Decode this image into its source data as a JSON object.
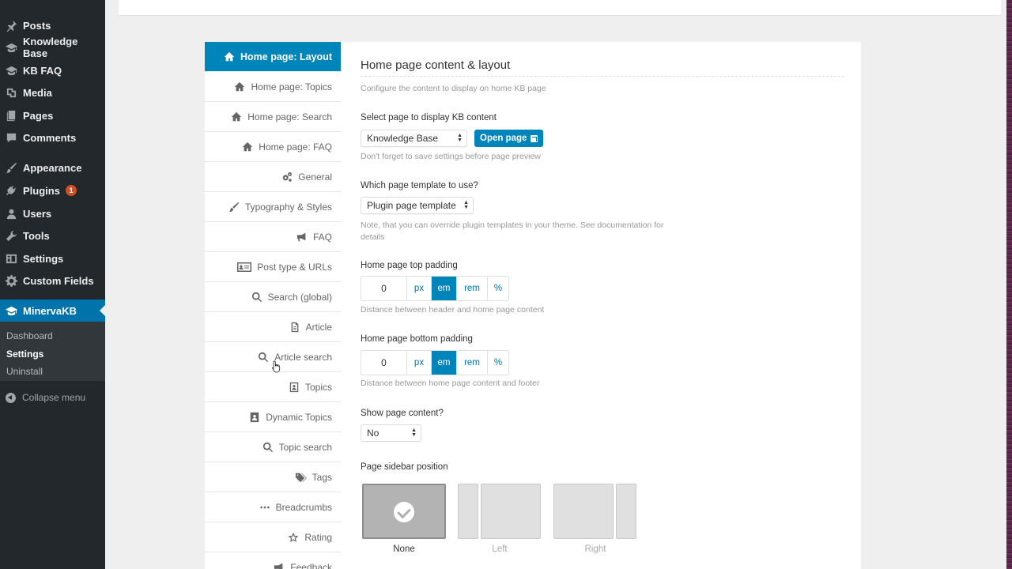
{
  "admin_menu": {
    "items": [
      {
        "label": "Posts",
        "icon": "pin-icon"
      },
      {
        "label": "Knowledge Base",
        "icon": "graduation-cap-icon"
      },
      {
        "label": "KB FAQ",
        "icon": "graduation-cap-icon"
      },
      {
        "label": "Media",
        "icon": "media-icon"
      },
      {
        "label": "Pages",
        "icon": "pages-icon"
      },
      {
        "label": "Comments",
        "icon": "comment-icon"
      },
      {
        "label": "Appearance",
        "icon": "brush-icon"
      },
      {
        "label": "Plugins",
        "icon": "plug-icon",
        "badge": "1"
      },
      {
        "label": "Users",
        "icon": "user-icon"
      },
      {
        "label": "Tools",
        "icon": "wrench-icon"
      },
      {
        "label": "Settings",
        "icon": "settings-icon"
      },
      {
        "label": "Custom Fields",
        "icon": "gear-icon"
      },
      {
        "label": "MinervaKB",
        "icon": "graduation-cap-icon"
      }
    ],
    "submenu": [
      "Dashboard",
      "Settings",
      "Uninstall"
    ],
    "collapse_label": "Collapse menu"
  },
  "settings_nav": [
    {
      "label": "Home page: Layout",
      "icon": "home-icon",
      "active": true
    },
    {
      "label": "Home page: Topics",
      "icon": "home-icon"
    },
    {
      "label": "Home page: Search",
      "icon": "home-icon"
    },
    {
      "label": "Home page: FAQ",
      "icon": "home-icon"
    },
    {
      "label": "General",
      "icon": "cogs-icon"
    },
    {
      "label": "Typography & Styles",
      "icon": "paintbrush-icon"
    },
    {
      "label": "FAQ",
      "icon": "megaphone-icon"
    },
    {
      "label": "Post type & URLs",
      "icon": "id-card-icon"
    },
    {
      "label": "Search (global)",
      "icon": "search-icon"
    },
    {
      "label": "Article",
      "icon": "document-icon"
    },
    {
      "label": "Article search",
      "icon": "search-icon"
    },
    {
      "label": "Topics",
      "icon": "contact-book-icon"
    },
    {
      "label": "Dynamic Topics",
      "icon": "contact-book-icon"
    },
    {
      "label": "Topic search",
      "icon": "search-icon"
    },
    {
      "label": "Tags",
      "icon": "tags-icon"
    },
    {
      "label": "Breadcrumbs",
      "icon": "ellipsis-icon"
    },
    {
      "label": "Rating",
      "icon": "star-icon"
    },
    {
      "label": "Feedback",
      "icon": "megaphone-icon"
    }
  ],
  "content": {
    "title": "Home page content & layout",
    "subtitle": "Configure the content to display on home KB page",
    "select_page": {
      "label": "Select page to display KB content",
      "value": "Knowledge Base",
      "button": "Open page",
      "note": "Don't forget to save settings before page preview"
    },
    "template": {
      "label": "Which page template to use?",
      "value": "Plugin page template",
      "note_line1": "Note, that you can override plugin templates in your theme. See documentation for",
      "note_line2": "details"
    },
    "top_padding": {
      "label": "Home page top padding",
      "value": "0",
      "units": [
        "px",
        "em",
        "rem",
        "%"
      ],
      "selected_unit": "em",
      "note": "Distance between header and home page content"
    },
    "bottom_padding": {
      "label": "Home page bottom padding",
      "value": "0",
      "units": [
        "px",
        "em",
        "rem",
        "%"
      ],
      "selected_unit": "em",
      "note": "Distance between home page content and footer"
    },
    "show_content": {
      "label": "Show page content?",
      "value": "No"
    },
    "sidebar_position": {
      "label": "Page sidebar position",
      "options": [
        "None",
        "Left",
        "Right"
      ],
      "selected": "None"
    }
  }
}
